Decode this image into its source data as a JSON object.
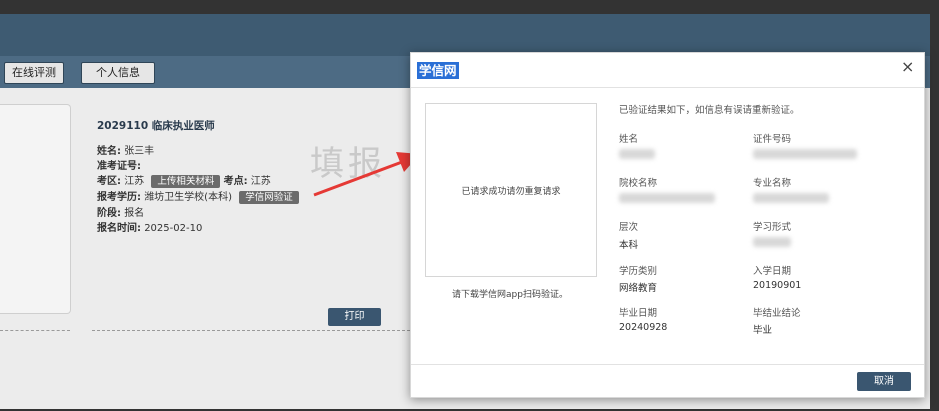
{
  "nav": {
    "online_eval": "在线评测",
    "personal_info": "个人信息"
  },
  "watermark": "填报",
  "exam": {
    "title": "2029110 临床执业医师",
    "name_label": "姓名:",
    "name": "张三丰",
    "ticket_label": "准考证号:",
    "region_label": "考区:",
    "region": "江苏",
    "upload_tag": "上传相关材料",
    "site_label": "考点:",
    "site": "江苏",
    "edu_label": "报考学历:",
    "edu": "潍坊卫生学校(本科)",
    "chsi_tag": "学信网验证",
    "stage_label": "阶段:",
    "stage": "报名",
    "time_label": "报名时间:",
    "time": "2025-02-10",
    "print": "打印"
  },
  "modal": {
    "title": "学信网",
    "close": "×",
    "qr_text": "已请求成功请勿重复请求",
    "qr_note": "请下载学信网app扫码验证。",
    "verified": "已验证结果如下，如信息有误请重新验证。",
    "fields": {
      "name": "姓名",
      "id_no": "证件号码",
      "school": "院校名称",
      "major": "专业名称",
      "level": "层次",
      "level_value": "本科",
      "mode": "学习形式",
      "type": "学历类别",
      "type_value": "网络教育",
      "enroll": "入学日期",
      "enroll_value": "20190901",
      "grad": "毕业日期",
      "grad_value": "20240928",
      "conclusion": "毕结业结论",
      "conclusion_value": "毕业"
    },
    "cancel": "取消"
  },
  "colors": {
    "topbar": "#3e5b72",
    "button": "#3a5670",
    "arrow": "#e53935",
    "title_highlight": "#2a6fd6"
  }
}
